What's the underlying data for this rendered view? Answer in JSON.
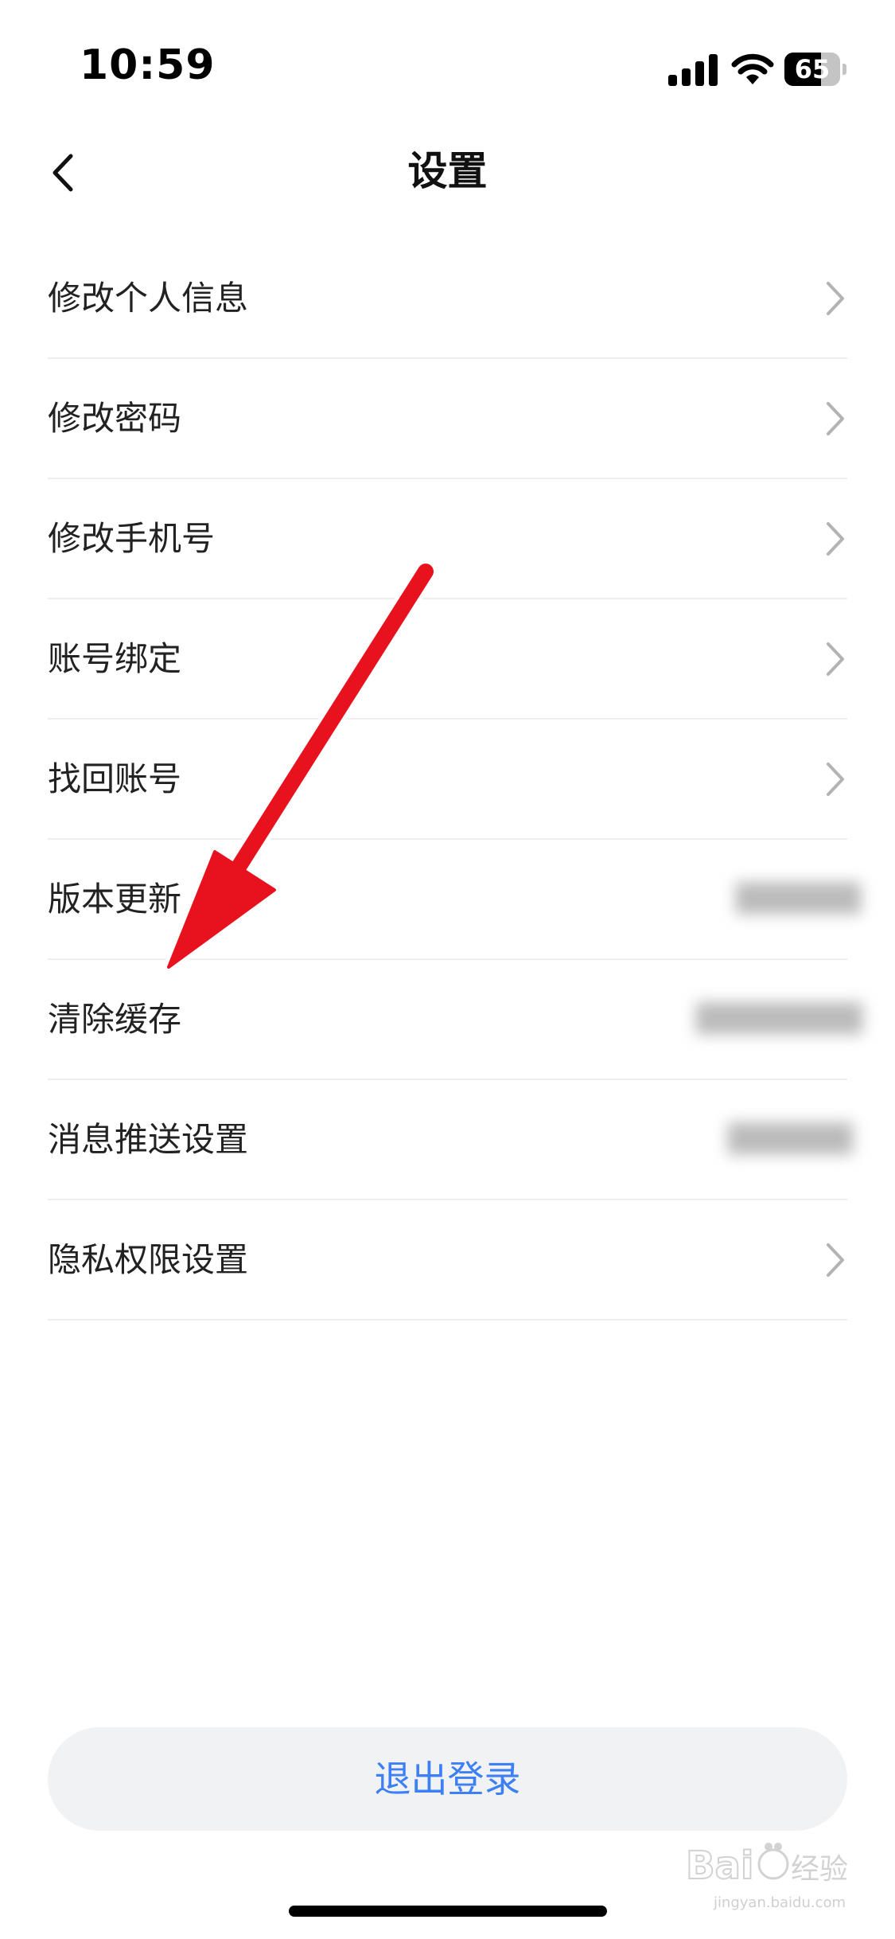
{
  "status_bar": {
    "time": "10:59",
    "battery": "65",
    "battery_level": 0.65,
    "signal_bars": 3
  },
  "header": {
    "title": "设置",
    "back_icon": "chevron-left-icon"
  },
  "settings": {
    "items": [
      {
        "label": "修改个人信息",
        "accessory": "chevron-right-icon"
      },
      {
        "label": "修改密码",
        "accessory": "chevron-right-icon"
      },
      {
        "label": "修改手机号",
        "accessory": "chevron-right-icon"
      },
      {
        "label": "账号绑定",
        "accessory": "chevron-right-icon"
      },
      {
        "label": "找回账号",
        "accessory": "chevron-right-icon"
      },
      {
        "label": "版本更新",
        "accessory": "blurred-value"
      },
      {
        "label": "清除缓存",
        "accessory": "blurred-value"
      },
      {
        "label": "消息推送设置",
        "accessory": "blurred-value"
      },
      {
        "label": "隐私权限设置",
        "accessory": "chevron-right-icon"
      }
    ]
  },
  "logout": {
    "label": "退出登录"
  },
  "watermark": {
    "logo_text": "Baidu经验",
    "caption": "jingyan.baidu.com"
  },
  "colors": {
    "accent_blue": "#3d7ff5",
    "annotation_red": "#e8121e",
    "divider": "#eeeeee",
    "logout_bg": "#f1f2f4"
  }
}
